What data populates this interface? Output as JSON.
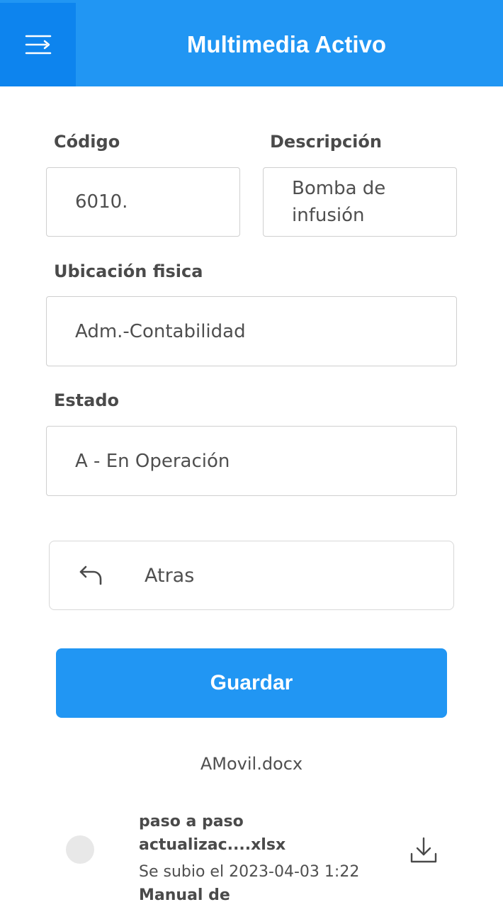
{
  "header": {
    "title": "Multimedia Activo",
    "menu_icon": "menu-icon"
  },
  "form": {
    "codigo": {
      "label": "Código",
      "value": "6010."
    },
    "descripcion": {
      "label": "Descripción",
      "value": "Bomba de infusión"
    },
    "ubicacion": {
      "label": "Ubicación fisica",
      "value": "Adm.-Contabilidad"
    },
    "estado": {
      "label": "Estado",
      "value": "A - En Operación"
    }
  },
  "actions": {
    "back_label": "Atras",
    "back_icon": "undo-arrow-icon",
    "save_label": "Guardar"
  },
  "files": {
    "header_file": "AMovil.docx",
    "items": [
      {
        "title": "paso a paso actualizac....xlsx",
        "uploaded": "Se subio el 2023-04-03 1:22",
        "icon": "download-icon"
      },
      {
        "title": "Manual de"
      }
    ]
  },
  "colors": {
    "primary": "#2196f3",
    "primary_dark": "#0d84ee",
    "text": "#4a4a4a",
    "border": "#cfcfcf"
  }
}
